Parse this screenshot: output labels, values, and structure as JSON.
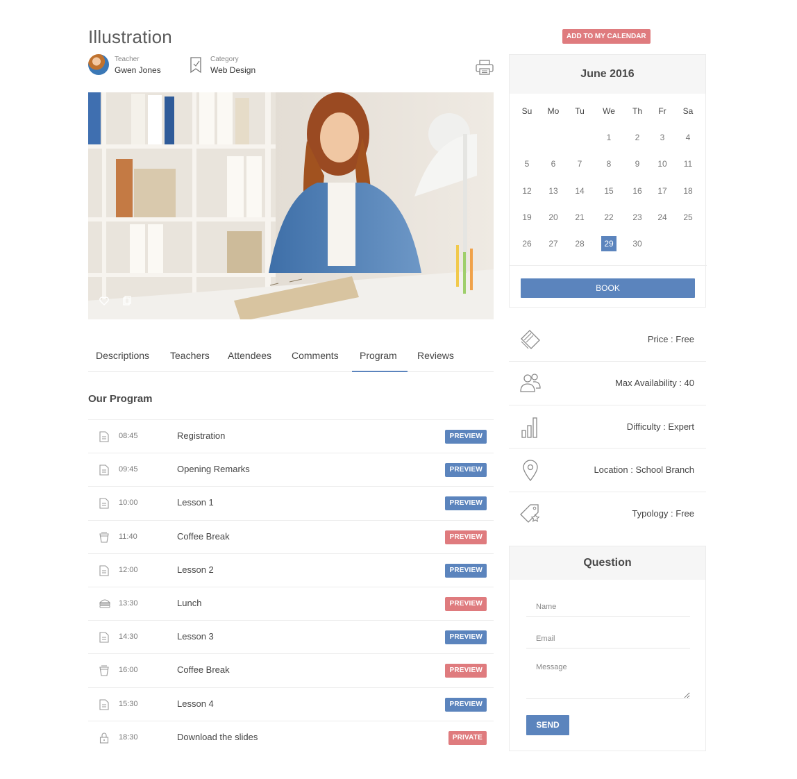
{
  "event": {
    "title": "Illustration",
    "teacher_label": "Teacher",
    "teacher_name": "Gwen Jones",
    "category_label": "Category",
    "category_name": "Web Design"
  },
  "tabs": [
    "Descriptions",
    "Teachers",
    "Attendees",
    "Comments",
    "Program",
    "Reviews"
  ],
  "active_tab": "Program",
  "program": {
    "title": "Our Program",
    "rows": [
      {
        "icon": "document-icon",
        "time": "08:45",
        "name": "Registration",
        "badge": "PREVIEW",
        "color": "#5b84bd"
      },
      {
        "icon": "document-icon",
        "time": "09:45",
        "name": "Opening Remarks",
        "badge": "PREVIEW",
        "color": "#5b84bd"
      },
      {
        "icon": "document-icon",
        "time": "10:00",
        "name": "Lesson 1",
        "badge": "PREVIEW",
        "color": "#5b84bd"
      },
      {
        "icon": "coffee-cup-icon",
        "time": "11:40",
        "name": "Coffee Break",
        "badge": "PREVIEW",
        "color": "#df7b7e"
      },
      {
        "icon": "document-icon",
        "time": "12:00",
        "name": "Lesson 2",
        "badge": "PREVIEW",
        "color": "#5b84bd"
      },
      {
        "icon": "burger-icon",
        "time": "13:30",
        "name": "Lunch",
        "badge": "PREVIEW",
        "color": "#df7b7e"
      },
      {
        "icon": "document-icon",
        "time": "14:30",
        "name": "Lesson 3",
        "badge": "PREVIEW",
        "color": "#5b84bd"
      },
      {
        "icon": "coffee-cup-icon",
        "time": "16:00",
        "name": "Coffee Break",
        "badge": "PREVIEW",
        "color": "#df7b7e"
      },
      {
        "icon": "document-icon",
        "time": "15:30",
        "name": "Lesson 4",
        "badge": "PREVIEW",
        "color": "#5b84bd"
      },
      {
        "icon": "lock-icon",
        "time": "18:30",
        "name": "Download the slides",
        "badge": "PRIVATE",
        "color": "#df7b7e"
      }
    ]
  },
  "calendar": {
    "add_label": "ADD TO MY CALENDAR",
    "month": "June 2016",
    "weekdays": [
      "Su",
      "Mo",
      "Tu",
      "We",
      "Th",
      "Fr",
      "Sa"
    ],
    "first_weekday": 3,
    "days_in_month": 30,
    "selected_day": 29,
    "book_label": "BOOK"
  },
  "info": [
    {
      "icon": "price-tag-icon",
      "text": "Price : Free"
    },
    {
      "icon": "users-icon",
      "text": "Max Availability : 40"
    },
    {
      "icon": "bar-chart-icon",
      "text": "Difficulty : Expert"
    },
    {
      "icon": "map-pin-icon",
      "text": "Location : School Branch"
    },
    {
      "icon": "tag-star-icon",
      "text": "Typology : Free"
    }
  ],
  "question": {
    "title": "Question",
    "name_placeholder": "Name",
    "email_placeholder": "Email",
    "message_placeholder": "Message",
    "send_label": "SEND"
  },
  "colors": {
    "accent": "#5b84bd",
    "alert": "#df7b7e"
  }
}
